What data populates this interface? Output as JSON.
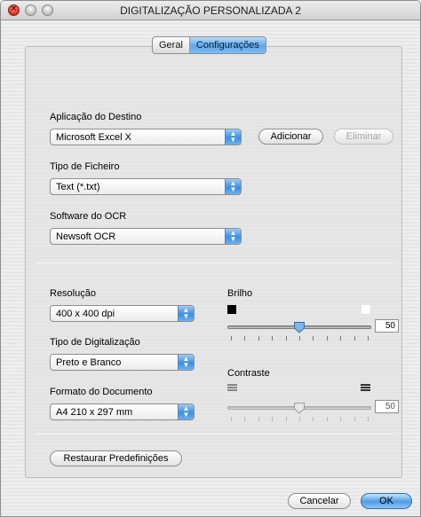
{
  "window": {
    "title": "DIGITALIZAÇÃO PERSONALIZADA 2"
  },
  "tabs": [
    {
      "label": "Geral",
      "active": false
    },
    {
      "label": "Configurações",
      "active": true
    }
  ],
  "destination": {
    "label": "Aplicação do Destino",
    "value": "Microsoft Excel X",
    "add_label": "Adicionar",
    "remove_label": "Eliminar"
  },
  "file_type": {
    "label": "Tipo de Ficheiro",
    "value": "Text (*.txt)"
  },
  "ocr": {
    "label": "Software do OCR",
    "value": "Newsoft OCR"
  },
  "resolution": {
    "label": "Resolução",
    "value": "400 x 400 dpi"
  },
  "scan_type": {
    "label": "Tipo de Digitalização",
    "value": "Preto e Branco"
  },
  "doc_format": {
    "label": "Formato do Documento",
    "value": "A4 210 x 297 mm"
  },
  "brightness": {
    "label": "Brilho",
    "value": "50",
    "level": 0.5
  },
  "contrast": {
    "label": "Contraste",
    "value": "50",
    "level": 0.5,
    "enabled": false
  },
  "restore_label": "Restaurar Predefinições",
  "footer": {
    "cancel_label": "Cancelar",
    "ok_label": "OK"
  },
  "colors": {
    "accent": "#4e9ce6",
    "close": "#d4281c"
  },
  "icons": {
    "brightness_low": "black-square-icon",
    "brightness_high": "white-square-icon",
    "contrast_low": "low-contrast-lines-icon",
    "contrast_high": "high-contrast-lines-icon"
  }
}
